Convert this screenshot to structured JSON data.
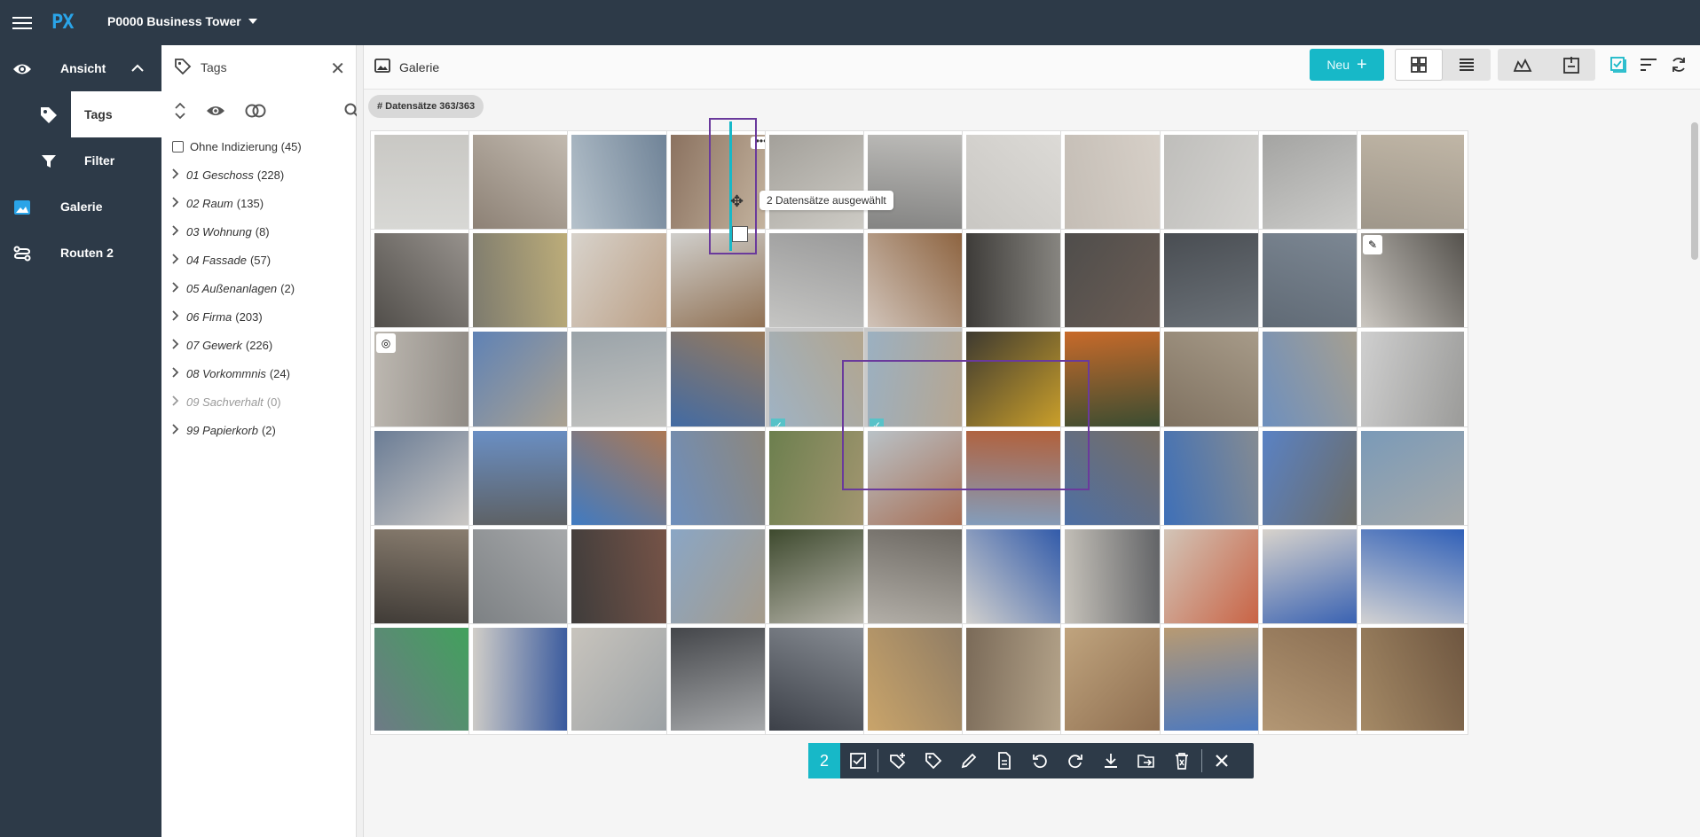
{
  "app": {
    "logo": "PX",
    "project": "P0000 Business Tower"
  },
  "nav": {
    "items": [
      {
        "label": "Ansicht",
        "icon": "eye-icon"
      },
      {
        "label": "Tags",
        "icon": "tag-icon"
      },
      {
        "label": "Filter",
        "icon": "filter-icon"
      },
      {
        "label": "Galerie",
        "icon": "image-icon"
      },
      {
        "label": "Routen 2",
        "icon": "route-icon"
      }
    ]
  },
  "tags": {
    "title": "Tags",
    "unindexed": "Ohne Indizierung (45)",
    "items": [
      {
        "name": "01 Geschoss",
        "count": "(228)"
      },
      {
        "name": "02 Raum",
        "count": "(135)"
      },
      {
        "name": "03 Wohnung",
        "count": "(8)"
      },
      {
        "name": "04 Fassade",
        "count": "(57)"
      },
      {
        "name": "05 Außenanlagen",
        "count": "(2)"
      },
      {
        "name": "06 Firma",
        "count": "(203)"
      },
      {
        "name": "07 Gewerk",
        "count": "(226)"
      },
      {
        "name": "08 Vorkommnis",
        "count": "(24)"
      },
      {
        "name": "09 Sachverhalt",
        "count": "(0)"
      },
      {
        "name": "99 Papierkorb",
        "count": "(2)"
      }
    ]
  },
  "gallery": {
    "title": "Galerie",
    "new_label": "Neu",
    "records_chip": "# Datensätze 363/363",
    "tooltip": "2 Datensätze ausgewählt",
    "selected_count": "2"
  },
  "colors": {
    "accent": "#17b8c8",
    "nav_bg": "#2d3a48",
    "selection": "#6a3a9c"
  }
}
